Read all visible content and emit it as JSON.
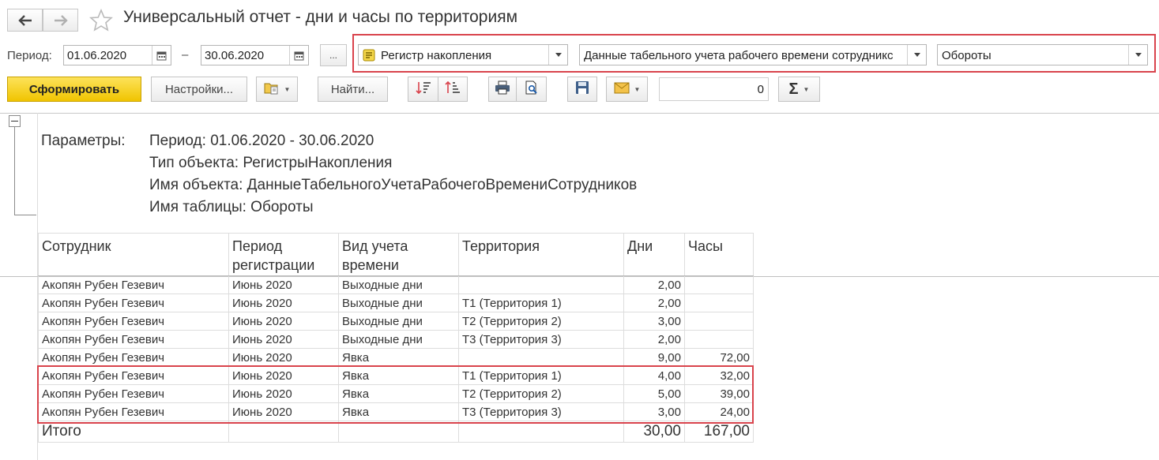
{
  "window": {
    "title": "Универсальный отчет - дни и часы по территориям"
  },
  "icons": {
    "back": "arrow-left-icon",
    "forward": "arrow-right-icon",
    "favorite": "star-icon"
  },
  "period": {
    "label": "Период:",
    "from": "01.06.2020",
    "separator": "–",
    "to": "30.06.2020",
    "more_label": "..."
  },
  "selectors": {
    "object_type": "Регистр накопления",
    "object_name": "Данные табельного учета рабочего времени сотрудникс",
    "table_name": "Обороты"
  },
  "toolbar": {
    "generate_label": "Сформировать",
    "settings_label": "Настройки...",
    "find_label": "Найти...",
    "sum_value": "0",
    "sum_symbol": "Σ"
  },
  "parameters": {
    "label": "Параметры:",
    "lines": [
      "Период: 01.06.2020 - 30.06.2020",
      "Тип объекта: РегистрыНакопления",
      "Имя объекта: ДанныеТабельногоУчетаРабочегоВремениСотрудников",
      "Имя таблицы: Обороты"
    ]
  },
  "table": {
    "headers": {
      "employee": "Сотрудник",
      "period_line1": "Период",
      "period_line2": "регистрации",
      "kind_line1": "Вид учета",
      "kind_line2": "времени",
      "territory": "Территория",
      "days": "Дни",
      "hours": "Часы"
    },
    "rows": [
      {
        "employee": "Акопян Рубен Гезевич",
        "period": "Июнь 2020",
        "kind": "Выходные дни",
        "territory": "",
        "days": "2,00",
        "hours": ""
      },
      {
        "employee": "Акопян Рубен Гезевич",
        "period": "Июнь 2020",
        "kind": "Выходные дни",
        "territory": "Т1 (Территория 1)",
        "days": "2,00",
        "hours": ""
      },
      {
        "employee": "Акопян Рубен Гезевич",
        "period": "Июнь 2020",
        "kind": "Выходные дни",
        "territory": "Т2 (Территория 2)",
        "days": "3,00",
        "hours": ""
      },
      {
        "employee": "Акопян Рубен Гезевич",
        "period": "Июнь 2020",
        "kind": "Выходные дни",
        "territory": "Т3 (Территория 3)",
        "days": "2,00",
        "hours": ""
      },
      {
        "employee": "Акопян Рубен Гезевич",
        "period": "Июнь 2020",
        "kind": "Явка",
        "territory": "",
        "days": "9,00",
        "hours": "72,00"
      },
      {
        "employee": "Акопян Рубен Гезевич",
        "period": "Июнь 2020",
        "kind": "Явка",
        "territory": "Т1 (Территория 1)",
        "days": "4,00",
        "hours": "32,00"
      },
      {
        "employee": "Акопян Рубен Гезевич",
        "period": "Июнь 2020",
        "kind": "Явка",
        "territory": "Т2 (Территория 2)",
        "days": "5,00",
        "hours": "39,00"
      },
      {
        "employee": "Акопян Рубен Гезевич",
        "period": "Июнь 2020",
        "kind": "Явка",
        "territory": "Т3 (Территория 3)",
        "days": "3,00",
        "hours": "24,00"
      }
    ],
    "total": {
      "label": "Итого",
      "days": "30,00",
      "hours": "167,00"
    }
  },
  "colors": {
    "highlight": "#d9434c",
    "primary_button": "#f5cf1e"
  }
}
